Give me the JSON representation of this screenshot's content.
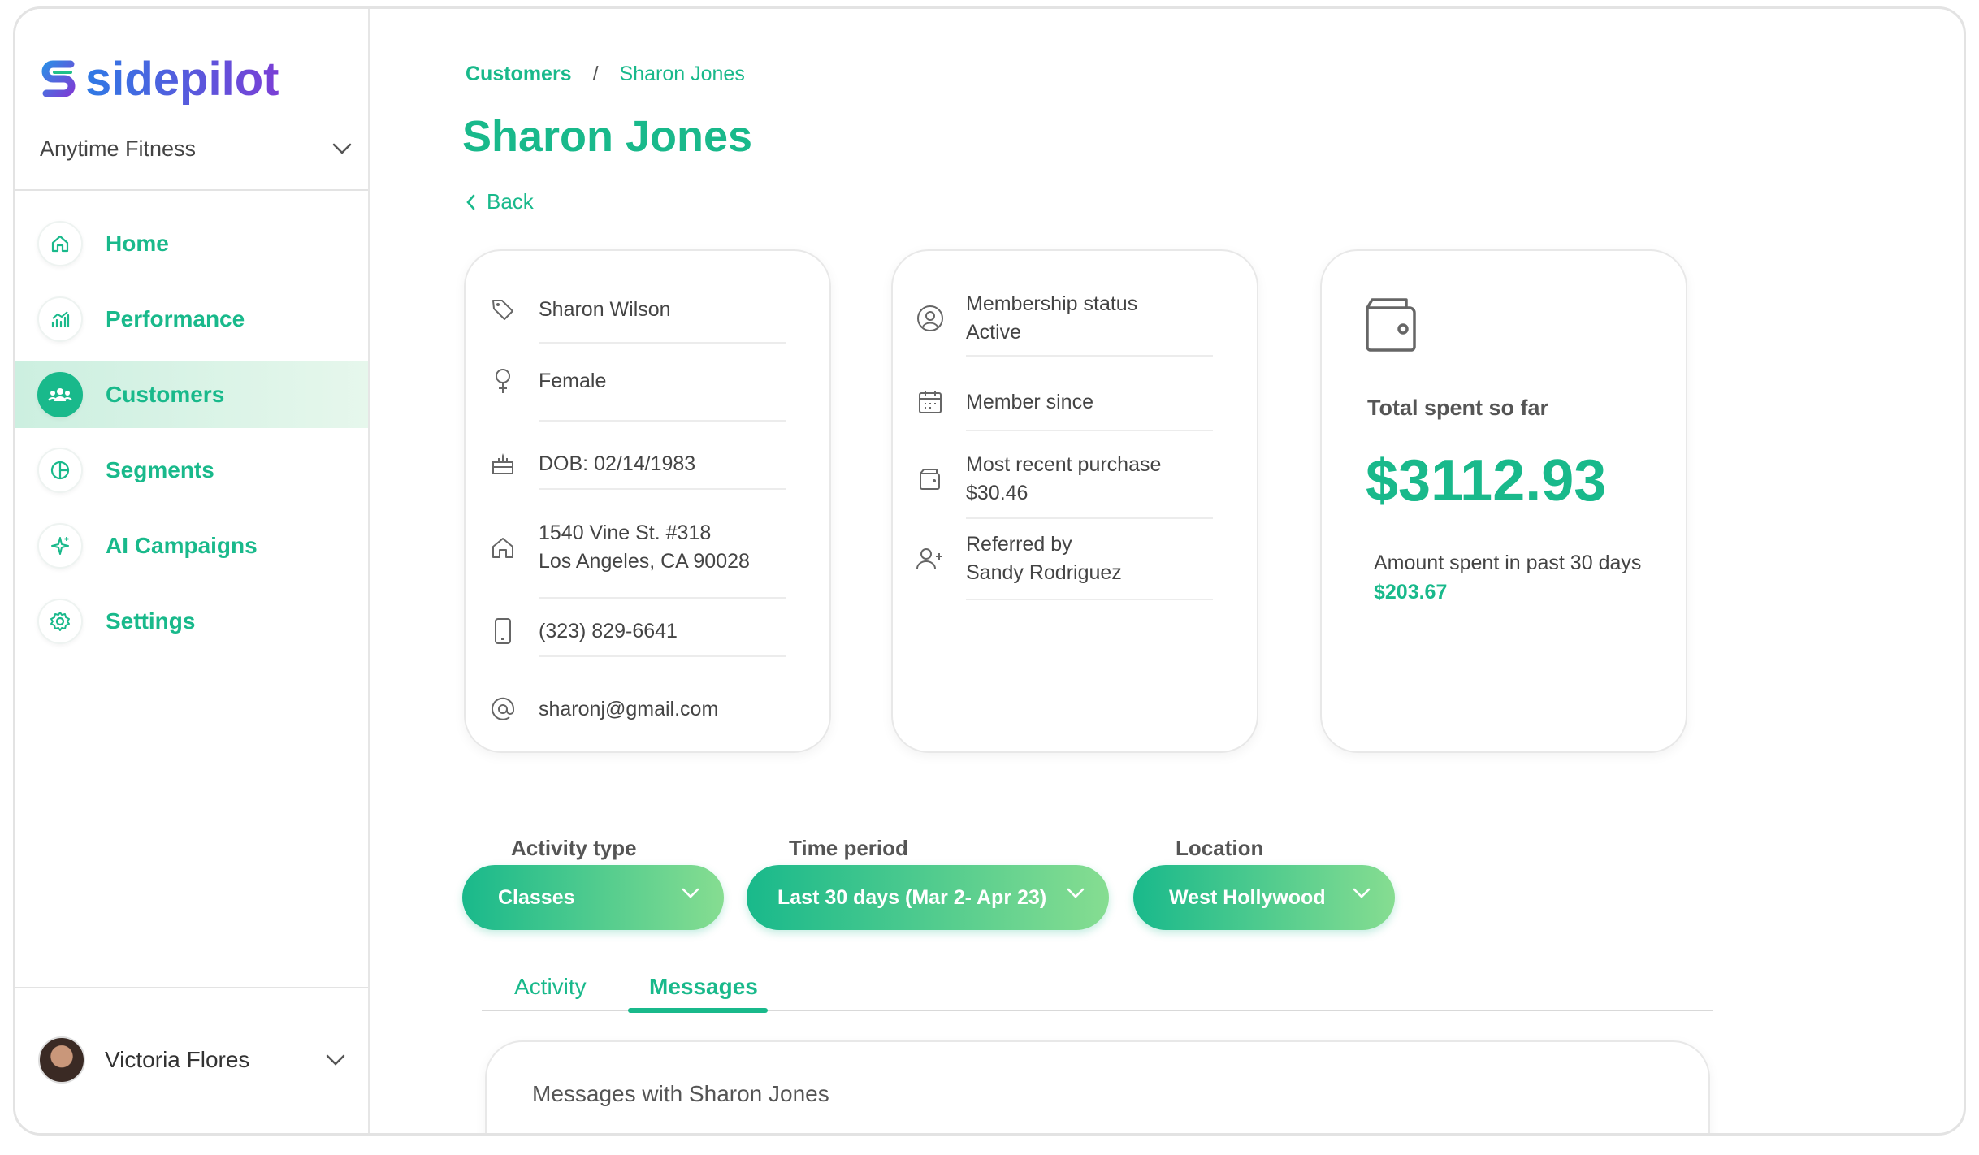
{
  "brand": {
    "name": "sidepilot",
    "accent": "#19b98b"
  },
  "org": {
    "name": "Anytime Fitness"
  },
  "nav": [
    {
      "label": "Home",
      "icon": "home-icon"
    },
    {
      "label": "Performance",
      "icon": "chart-icon"
    },
    {
      "label": "Customers",
      "icon": "users-icon",
      "active": true
    },
    {
      "label": "Segments",
      "icon": "pie-icon"
    },
    {
      "label": "AI Campaigns",
      "icon": "sparkle-icon"
    },
    {
      "label": "Settings",
      "icon": "gear-icon"
    }
  ],
  "user": {
    "name": "Victoria Flores"
  },
  "breadcrumb": {
    "parent": "Customers",
    "separator": "/",
    "current": "Sharon Jones"
  },
  "page": {
    "title": "Sharon Jones",
    "back_label": "Back"
  },
  "profile": {
    "name": "Sharon Wilson",
    "gender": "Female",
    "dob": "DOB: 02/14/1983",
    "address_line1": "1540 Vine St. #318",
    "address_line2": "Los Angeles, CA 90028",
    "phone": "(323) 829-6641",
    "email": "sharonj@gmail.com"
  },
  "membership": {
    "status_label": "Membership status",
    "status_value": "Active",
    "since_label": "Member since",
    "purchase_label": "Most recent purchase",
    "purchase_value": "$30.46",
    "referred_label": "Referred by",
    "referred_value": "Sandy Rodriguez"
  },
  "spend": {
    "total_label": "Total spent so far",
    "total_value": "$3112.93",
    "past_label": "Amount spent in past 30 days",
    "past_value": "$203.67"
  },
  "filters": {
    "activity_label": "Activity type",
    "activity_value": "Classes",
    "period_label": "Time period",
    "period_value": "Last 30 days (Mar 2- Apr 23)",
    "location_label": "Location",
    "location_value": "West Hollywood"
  },
  "tabs": {
    "activity": "Activity",
    "messages": "Messages",
    "active": "Messages"
  },
  "messages": {
    "title": "Messages with Sharon Jones"
  }
}
